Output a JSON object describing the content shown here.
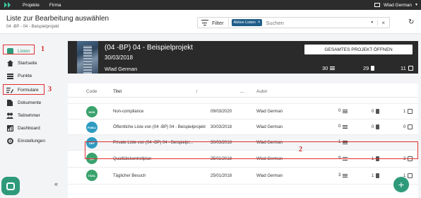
{
  "topbar": {
    "nav": [
      "Projekte",
      "Firma"
    ],
    "user": "Wlad German"
  },
  "header": {
    "title": "Liste zur Bearbeitung auswählen",
    "breadcrumb": "04 -BP - 04 - Beispielprojekt",
    "filter_label": "Filter",
    "chip_label": "Aktive Listen",
    "search_placeholder": "Suchen"
  },
  "sidebar": {
    "items": [
      {
        "label": "Listen",
        "icon": "list-square-icon"
      },
      {
        "label": "Startseite",
        "icon": "home-icon"
      },
      {
        "label": "Punkte",
        "icon": "stack-icon"
      },
      {
        "label": "Formulare",
        "icon": "form-icon"
      },
      {
        "label": "Dokumente",
        "icon": "document-icon"
      },
      {
        "label": "Teilnehmer",
        "icon": "people-icon"
      },
      {
        "label": "Dashboard",
        "icon": "dashboard-icon"
      },
      {
        "label": "Einstellungen",
        "icon": "gear-icon"
      }
    ],
    "markers": [
      "1",
      "3"
    ]
  },
  "banner": {
    "title": "(04 -BP) 04 - Beispielprojekt",
    "date": "30/03/2018",
    "owner": "Wlad German",
    "button": "GESAMTES PROJEKT ÖFFNEN",
    "stats": [
      "30",
      "29",
      "11"
    ]
  },
  "table": {
    "columns": [
      "Code",
      "Titel",
      "Autor"
    ],
    "rows": [
      {
        "code": "NON",
        "color": "#3aa26d",
        "title": "Non-compliance",
        "date": "09/03/2020",
        "author": "Wlad German",
        "n1": "0",
        "n2": "0",
        "n3": "1"
      },
      {
        "code": "PUBLI",
        "color": "#2e9bc1",
        "title": "Öffentliche Liste von (04 -BP) 04 - Beispielprojekt",
        "date": "30/03/2018",
        "author": "Wlad German",
        "n1": "0",
        "n2": "0",
        "n3": "0"
      },
      {
        "code": "DEF",
        "color": "#2e9bc1",
        "title": "Private Liste von (04 -BP) 04 - Beispielpr...",
        "date": "30/03/2018",
        "author": "Wlad German",
        "n1": "1",
        "n2": "",
        "n3": ""
      },
      {
        "code": "QA",
        "color": "#3aa26d",
        "title": "Qualitätskontrollplan",
        "date": "25/01/2018",
        "author": "Wlad German",
        "n1": "9",
        "n2": "1",
        "n3": "3"
      },
      {
        "code": "TÄGL",
        "color": "#3aa26d",
        "title": "Täglicher Besuch",
        "date": "25/01/2018",
        "author": "Wlad German",
        "n1": "3",
        "n2": "1",
        "n3": "1"
      }
    ],
    "marker": "2"
  }
}
